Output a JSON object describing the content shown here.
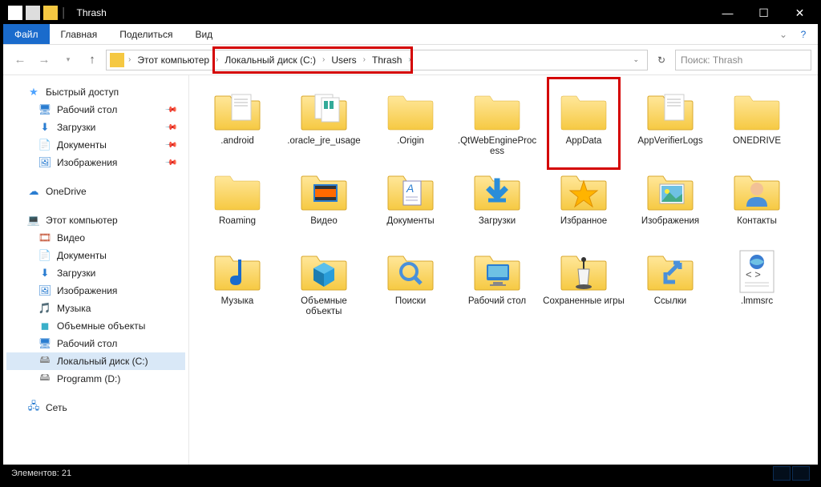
{
  "window": {
    "title": "Thrash"
  },
  "win_icons": {
    "min": "—",
    "max": "☐",
    "close": "✕"
  },
  "ribbon": {
    "file": "Файл",
    "tabs": [
      "Главная",
      "Поделиться",
      "Вид"
    ],
    "help": "?"
  },
  "nav": {
    "back": "←",
    "fwd": "→",
    "up": "↑",
    "refresh": "↻",
    "addr": [
      "Этот компьютер",
      "Локальный диск (C:)",
      "Users",
      "Thrash"
    ]
  },
  "search": {
    "placeholder": "Поиск: Thrash"
  },
  "sidebar": {
    "quick": "Быстрый доступ",
    "quick_items": [
      {
        "label": "Рабочий стол",
        "icon": "desk",
        "pin": true
      },
      {
        "label": "Загрузки",
        "icon": "down",
        "pin": true
      },
      {
        "label": "Документы",
        "icon": "doc",
        "pin": true
      },
      {
        "label": "Изображения",
        "icon": "img",
        "pin": true
      }
    ],
    "onedrive": "OneDrive",
    "this_pc": "Этот компьютер",
    "pc_items": [
      {
        "label": "Видео",
        "icon": "vid"
      },
      {
        "label": "Документы",
        "icon": "doc"
      },
      {
        "label": "Загрузки",
        "icon": "down"
      },
      {
        "label": "Изображения",
        "icon": "img"
      },
      {
        "label": "Музыка",
        "icon": "mus"
      },
      {
        "label": "Объемные объекты",
        "icon": "3d"
      },
      {
        "label": "Рабочий стол",
        "icon": "desk"
      },
      {
        "label": "Локальный диск (C:)",
        "icon": "drv",
        "sel": true
      },
      {
        "label": "Programm (D:)",
        "icon": "drv"
      }
    ],
    "network": "Сеть"
  },
  "folders": {
    "row1": [
      {
        "name": ".android",
        "type": "folder-file"
      },
      {
        "name": ".oracle_jre_usage",
        "type": "folder-file2"
      },
      {
        "name": ".Origin",
        "type": "folder"
      },
      {
        "name": ".QtWebEngineProcess",
        "type": "folder"
      },
      {
        "name": "AppData",
        "type": "folder",
        "hl": true
      },
      {
        "name": "AppVerifierLogs",
        "type": "folder-file"
      },
      {
        "name": "ONEDRIVE",
        "type": "folder"
      }
    ],
    "row2": [
      {
        "name": "Roaming",
        "type": "folder"
      },
      {
        "name": "Видео",
        "type": "video"
      },
      {
        "name": "Документы",
        "type": "docs"
      },
      {
        "name": "Загрузки",
        "type": "download"
      },
      {
        "name": "Избранное",
        "type": "fav"
      },
      {
        "name": "Изображения",
        "type": "pics"
      },
      {
        "name": "Контакты",
        "type": "contacts"
      }
    ],
    "row3": [
      {
        "name": "Музыка",
        "type": "music"
      },
      {
        "name": "Объемные объекты",
        "type": "3d"
      },
      {
        "name": "Поиски",
        "type": "search"
      },
      {
        "name": "Рабочий стол",
        "type": "desktop"
      },
      {
        "name": "Сохраненные игры",
        "type": "games"
      },
      {
        "name": "Ссылки",
        "type": "links"
      },
      {
        "name": ".lmmsrc",
        "type": "xmlfile"
      }
    ]
  },
  "status": {
    "text": "Элементов: 21"
  }
}
